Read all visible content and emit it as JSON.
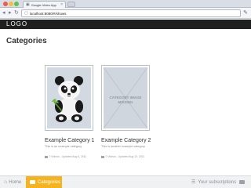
{
  "browser": {
    "tab_title": "Google Video App",
    "tab_favicon": "page-icon",
    "address": "localhost:8080/#/shows",
    "icons": [
      "back-icon",
      "forward-icon",
      "reload-icon",
      "page-icon",
      "wrench-icon"
    ]
  },
  "header": {
    "logo": "LOGO",
    "background": "#1f1f1f"
  },
  "page": {
    "title": "Categories"
  },
  "categories": [
    {
      "title": "Example Category 1",
      "description": "This is an example category",
      "meta": "0 Videos - Updated Aug 6, 2011",
      "thumbnail": "panda-image"
    },
    {
      "title": "Example Category 2",
      "description": "This is another example category",
      "meta": "0 Videos - Updated Aug 10, 2011",
      "thumbnail": "missing-image",
      "missing_text": "CATEGORY IMAGE MISSING"
    }
  ],
  "bottom_nav": {
    "home": "Home",
    "categories": "Categories",
    "subscriptions": "Your subscriptions",
    "active": "Categories",
    "accent": "#f5b41f"
  }
}
